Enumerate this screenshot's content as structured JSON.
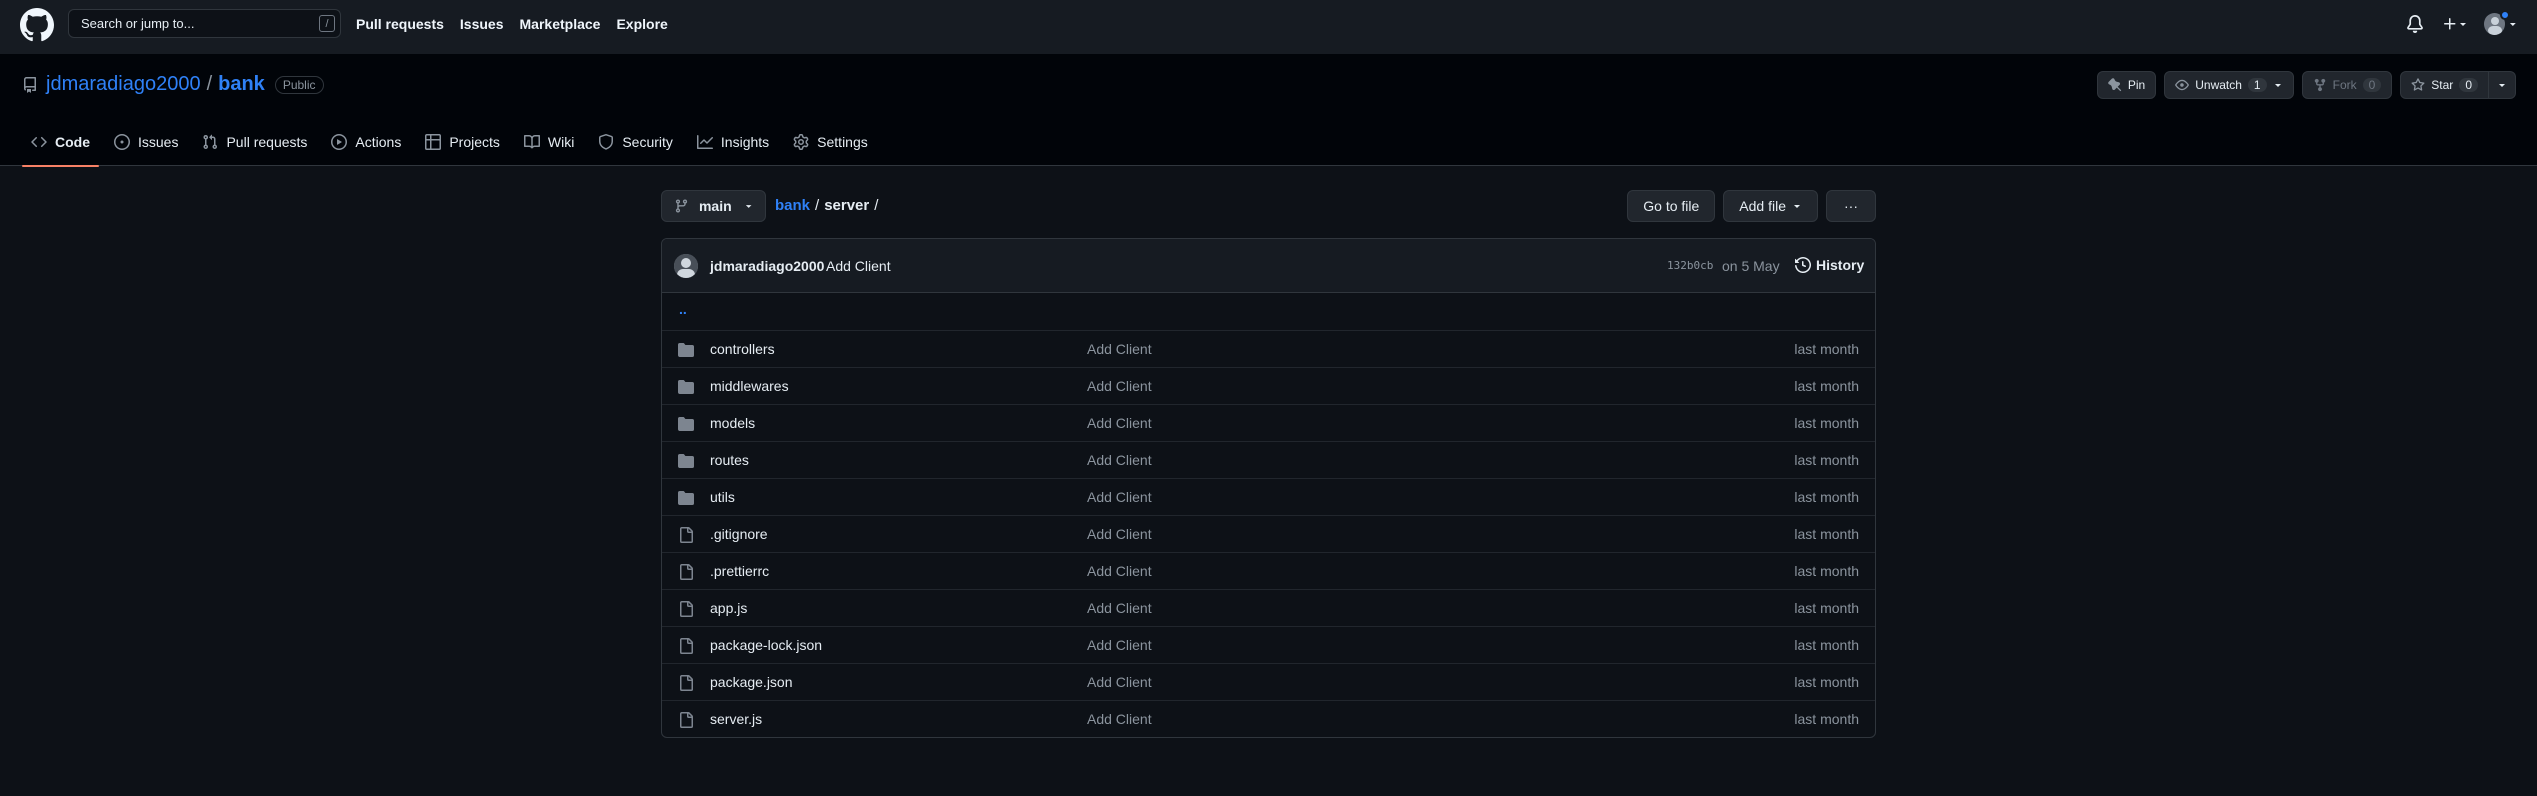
{
  "header": {
    "search_placeholder": "Search or jump to...",
    "search_shortcut": "/",
    "nav": [
      "Pull requests",
      "Issues",
      "Marketplace",
      "Explore"
    ]
  },
  "repo": {
    "owner": "jdmaradiago2000",
    "separator": "/",
    "name": "bank",
    "visibility": "Public",
    "pin_label": "Pin",
    "unwatch_label": "Unwatch",
    "watch_count": "1",
    "fork_label": "Fork",
    "fork_count": "0",
    "star_label": "Star",
    "star_count": "0"
  },
  "tabs": [
    {
      "label": "Code",
      "icon": "code-icon"
    },
    {
      "label": "Issues",
      "icon": "issue-icon"
    },
    {
      "label": "Pull requests",
      "icon": "pull-request-icon"
    },
    {
      "label": "Actions",
      "icon": "play-icon"
    },
    {
      "label": "Projects",
      "icon": "table-icon"
    },
    {
      "label": "Wiki",
      "icon": "book-icon"
    },
    {
      "label": "Security",
      "icon": "shield-icon"
    },
    {
      "label": "Insights",
      "icon": "graph-icon"
    },
    {
      "label": "Settings",
      "icon": "gear-icon"
    }
  ],
  "file_nav": {
    "branch": "main",
    "crumb_repo": "bank",
    "crumb_dir": "server",
    "crumb_sep": "/",
    "go_to_file": "Go to file",
    "add_file": "Add file",
    "more": "···"
  },
  "commit": {
    "author": "jdmaradiago2000",
    "message": "Add Client",
    "sha": "132b0cb",
    "date": "on 5 May",
    "history_label": "History"
  },
  "updir": "..",
  "files": [
    {
      "name": "controllers",
      "type": "dir",
      "message": "Add Client",
      "age": "last month"
    },
    {
      "name": "middlewares",
      "type": "dir",
      "message": "Add Client",
      "age": "last month"
    },
    {
      "name": "models",
      "type": "dir",
      "message": "Add Client",
      "age": "last month"
    },
    {
      "name": "routes",
      "type": "dir",
      "message": "Add Client",
      "age": "last month"
    },
    {
      "name": "utils",
      "type": "dir",
      "message": "Add Client",
      "age": "last month"
    },
    {
      "name": ".gitignore",
      "type": "file",
      "message": "Add Client",
      "age": "last month"
    },
    {
      "name": ".prettierrc",
      "type": "file",
      "message": "Add Client",
      "age": "last month"
    },
    {
      "name": "app.js",
      "type": "file",
      "message": "Add Client",
      "age": "last month"
    },
    {
      "name": "package-lock.json",
      "type": "file",
      "message": "Add Client",
      "age": "last month"
    },
    {
      "name": "package.json",
      "type": "file",
      "message": "Add Client",
      "age": "last month"
    },
    {
      "name": "server.js",
      "type": "file",
      "message": "Add Client",
      "age": "last month"
    }
  ],
  "colors": {
    "background": "#0d1117",
    "header": "#161b22",
    "link": "#2f81f7",
    "active_tab_underline": "#f78166",
    "folder_icon": "#7d8590"
  }
}
